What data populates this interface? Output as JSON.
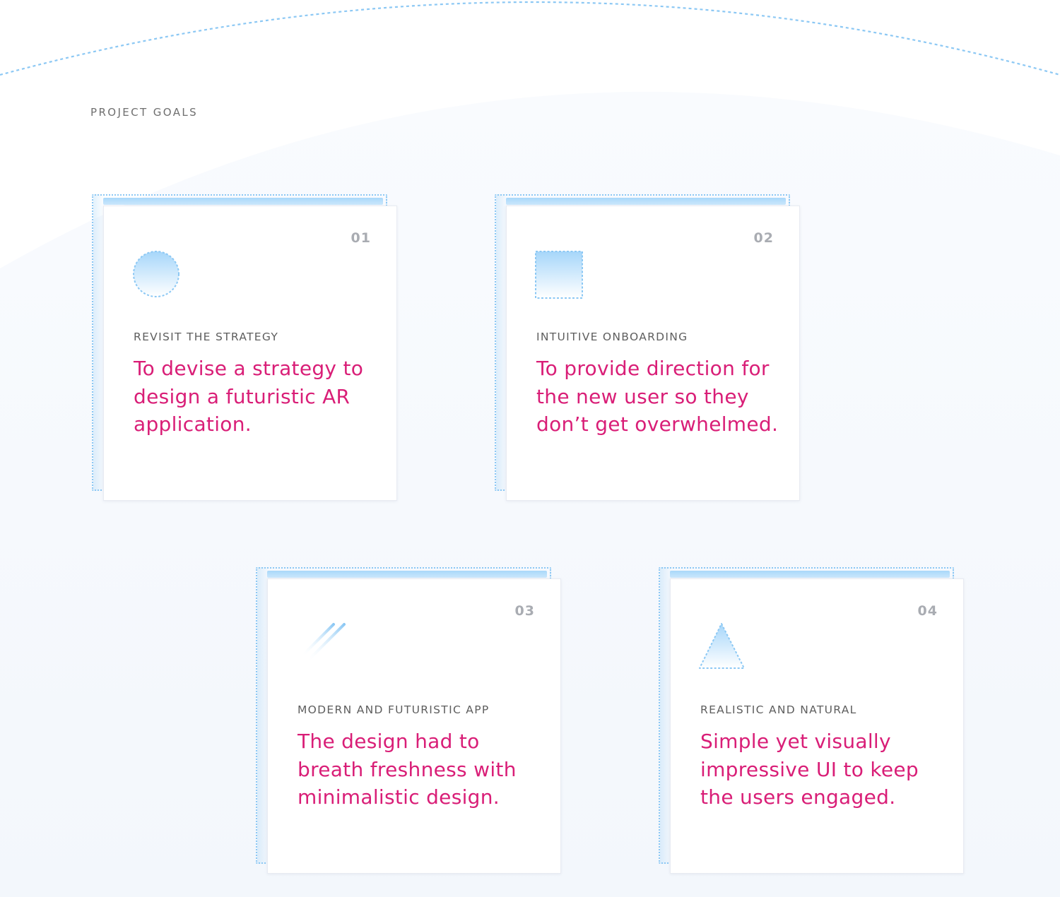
{
  "section": {
    "title": "PROJECT GOALS"
  },
  "colors": {
    "accent": "#d91e77",
    "dotted_line": "#8cc8f4",
    "icon_gradient_top": "#a6d6fa",
    "label": "#5e5e5e",
    "number": "#a9acb2"
  },
  "goals": [
    {
      "number": "01",
      "icon": "circle-icon",
      "label": "REVISIT THE STRATEGY",
      "text": "To devise a strategy to design a futuristic AR application."
    },
    {
      "number": "02",
      "icon": "square-icon",
      "label": "INTUITIVE ONBOARDING",
      "text": "To provide direction for the new user so they don’t get overwhelmed."
    },
    {
      "number": "03",
      "icon": "diagonal-lines-icon",
      "label": "MODERN AND FUTURISTIC APP",
      "text": "The design had to breath freshness with minimalistic design."
    },
    {
      "number": "04",
      "icon": "triangle-icon",
      "label": "REALISTIC AND NATURAL",
      "text": "Simple yet visually impressive UI to keep the users engaged."
    }
  ]
}
